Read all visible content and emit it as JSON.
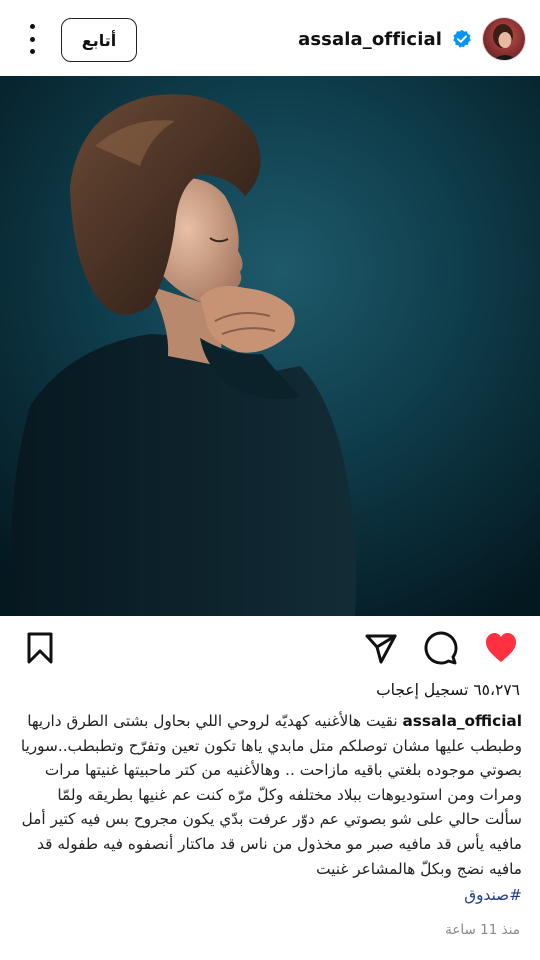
{
  "header": {
    "username": "assala_official",
    "follow_label": "أتابع",
    "verified_icon": "verified-badge-icon",
    "more_icon": "more-vertical-icon"
  },
  "post": {
    "image_alt": "portrait-photo",
    "likes_text": "٦٥،٢٧٦ تسجيل إعجاب",
    "caption": {
      "username": "assala_official",
      "text": "نقيت هالأغنيه كهديّه لروحي اللي بحاول بشتى الطرق داريها وطبطب عليها مشان توصلكم متل مابدي ياها تكون تعين وتفرّح وتطبطب..سوريا بصوتي موجوده بلغتي باقيه مازاحت .. وهالأغنيه من كتر ماحبيتها غنيتها مرات ومرات ومن استوديوهات ببلاد مختلفه وكلّ مرّه كنت عم غنيها بطريقه ولمّا سألت حالي على شو بصوتي عم دوّر عرفت بدّي يكون مجروح بس فيه كتير أمل مافيه يأس قد مافيه صبر مو مخذول من ناس قد ماكتار أنصفوه فيه طفوله قد مافيه نضج وبكلّ هالمشاعر غنيت",
      "hashtag": "#صندوق"
    },
    "time_ago": "منذ 11 ساعة"
  },
  "icons": {
    "like": "heart-filled-icon",
    "comment": "comment-icon",
    "share": "send-icon",
    "save": "bookmark-icon"
  },
  "colors": {
    "like_red": "#ff3040",
    "verified_blue": "#0095f6",
    "hashtag_blue": "#1f3d8a",
    "photo_bg": "#0e3a48"
  }
}
